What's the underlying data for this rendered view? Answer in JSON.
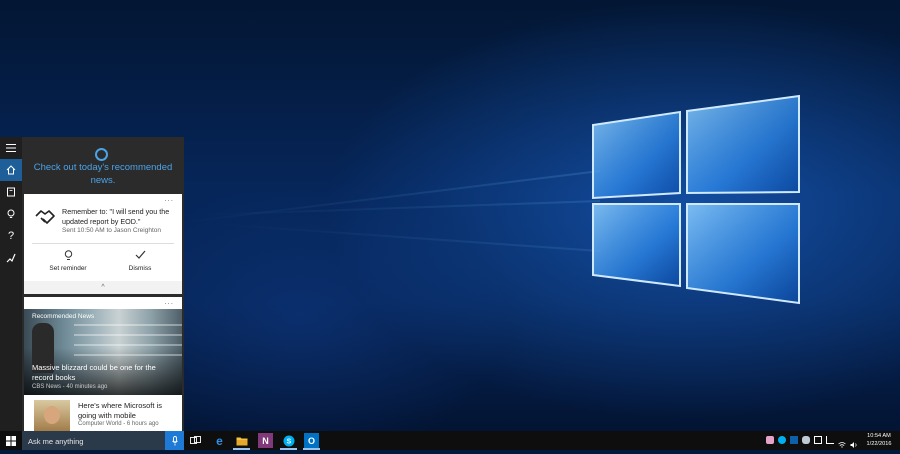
{
  "cortana": {
    "headline": "Check out today's recommended news.",
    "reminder": {
      "text": "Remember to: \"I will send you the updated report by EOD.\"",
      "sent": "Sent 10:50 AM to Jason Creighton",
      "set_label": "Set reminder",
      "dismiss_label": "Dismiss",
      "more": "..."
    },
    "news": {
      "section_label": "Recommended News",
      "headline": "Massive blizzard could be one for the record books",
      "source": "CBS News - 40 minutes ago",
      "more": "...",
      "story_title": "Here's where Microsoft is going with mobile",
      "story_source": "Computer World - 6 hours ago"
    }
  },
  "taskbar": {
    "search_placeholder": "Ask me anything",
    "time": "10:54 AM",
    "date": "1/22/2016"
  },
  "icons": [
    "hamburger-icon",
    "home-icon",
    "notebook-icon",
    "lightbulb-icon",
    "help-icon",
    "feedback-icon",
    "windows-start-icon",
    "microphone-icon",
    "task-view-icon",
    "edge-icon",
    "file-explorer-icon",
    "onenote-icon",
    "skype-icon",
    "outlook-icon"
  ],
  "colors": {
    "accent": "#1f7ad6",
    "cortana_blue": "#4aa3e8",
    "panel": "#2b2b2b",
    "taskbar": "#0e0e0e"
  }
}
